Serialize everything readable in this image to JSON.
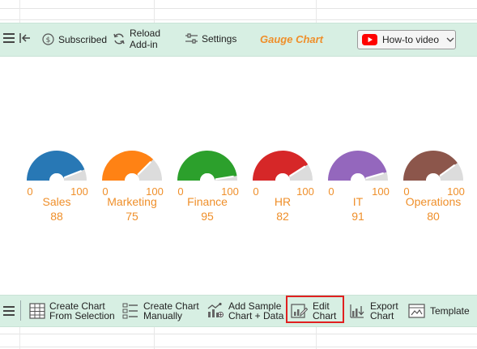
{
  "top_toolbar": {
    "subscribed_label": "Subscribed",
    "reload_label_1": "Reload",
    "reload_label_2": "Add-in",
    "settings_label": "Settings",
    "title": "Gauge Chart",
    "howto_label": "How-to video"
  },
  "chart_data": {
    "type": "gauge",
    "min": 0,
    "max": 100,
    "min_label": "0",
    "max_label": "100",
    "gauges": [
      {
        "name": "Sales",
        "value": 88,
        "value_label": "88",
        "color": "#2878b5"
      },
      {
        "name": "Marketing",
        "value": 75,
        "value_label": "75",
        "color": "#ff8214"
      },
      {
        "name": "Finance",
        "value": 95,
        "value_label": "95",
        "color": "#2ca02c"
      },
      {
        "name": "HR",
        "value": 82,
        "value_label": "82",
        "color": "#d62728"
      },
      {
        "name": "IT",
        "value": 91,
        "value_label": "91",
        "color": "#9467bd"
      },
      {
        "name": "Operations",
        "value": 80,
        "value_label": "80",
        "color": "#8c564b"
      }
    ],
    "remainder_color": "#dcdcdc",
    "label_color": "#ef8f2a"
  },
  "bottom_toolbar": {
    "create_selection_1": "Create Chart",
    "create_selection_2": "From Selection",
    "create_manual_1": "Create Chart",
    "create_manual_2": "Manually",
    "add_sample_1": "Add Sample",
    "add_sample_2": "Chart + Data",
    "edit_1": "Edit",
    "edit_2": "Chart",
    "export_1": "Export",
    "export_2": "Chart",
    "template": "Template"
  }
}
